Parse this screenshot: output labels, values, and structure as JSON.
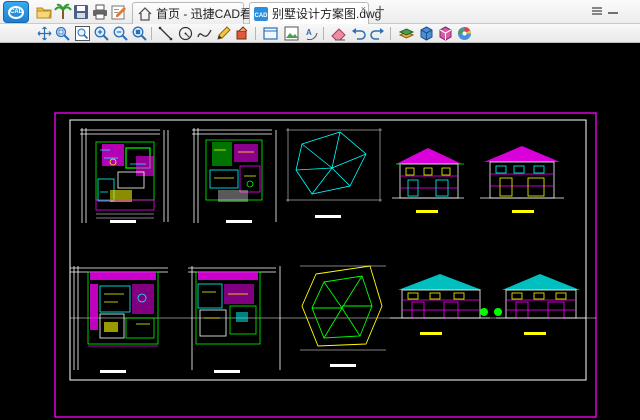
{
  "app": {
    "logo_text": "CAD"
  },
  "tabs": [
    {
      "label": "首页 - 迅捷CAD看图"
    },
    {
      "label": "别墅设计方案图.dwg"
    }
  ],
  "tab_close_glyph": "×",
  "tab_add_glyph": "+",
  "quick_toolbar": [
    "open-folder-icon",
    "palm-tree-icon",
    "save-icon",
    "print-icon",
    "edit-export-icon"
  ],
  "toolbar_icons": [
    "pan-icon",
    "zoom-window-icon",
    "zoom-realtime-icon",
    "zoom-in-icon",
    "zoom-out-icon",
    "zoom-extents-icon",
    "line-icon",
    "circle-icon",
    "curve-icon",
    "pencil-icon",
    "paint-icon",
    "frame-icon",
    "image-icon",
    "text-rotate-icon",
    "eraser-icon",
    "undo-icon",
    "redo-icon",
    "layer-icon",
    "cube-icon",
    "3d-box-icon",
    "color-wheel-icon"
  ],
  "colors": {
    "canvas_bg": "#000000",
    "magenta": "#ff00ff",
    "green": "#00ff00",
    "cyan": "#00ffff",
    "yellow": "#ffff00",
    "white": "#ffffff"
  }
}
